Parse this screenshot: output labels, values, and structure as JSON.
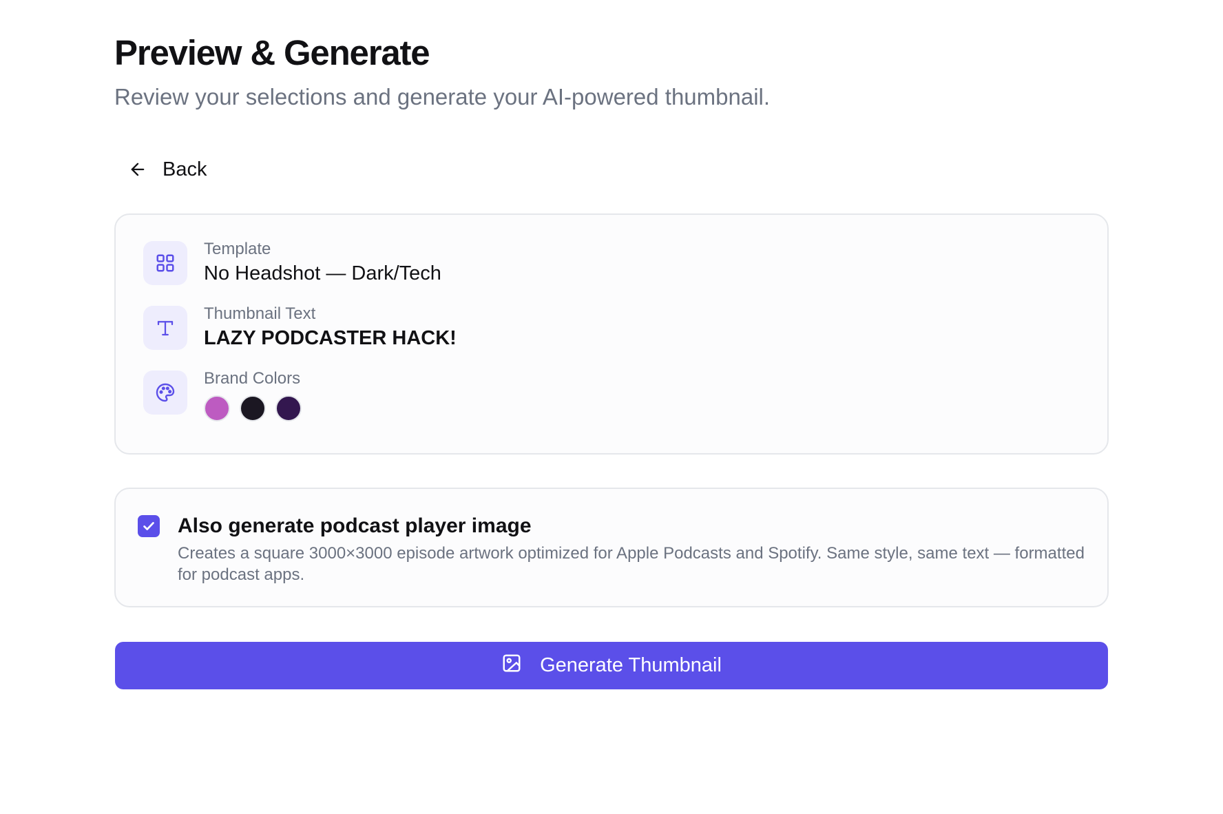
{
  "header": {
    "title": "Preview & Generate",
    "subtitle": "Review your selections and generate your AI-powered thumbnail."
  },
  "back_button": {
    "label": "Back",
    "icon": "arrow-left-icon"
  },
  "summary": {
    "template": {
      "label": "Template",
      "value": "No Headshot — Dark/Tech",
      "icon": "grid-icon"
    },
    "thumbnail_text": {
      "label": "Thumbnail Text",
      "value": "LAZY PODCASTER HACK!",
      "icon": "text-icon"
    },
    "brand_colors": {
      "label": "Brand Colors",
      "icon": "palette-icon",
      "colors": [
        "#bd5bc1",
        "#1b1722",
        "#33174f"
      ]
    }
  },
  "podcast_option": {
    "checked": true,
    "title": "Also generate podcast player image",
    "description": "Creates a square 3000×3000 episode artwork optimized for Apple Podcasts and Spotify. Same style, same text — formatted for podcast apps."
  },
  "generate_button": {
    "label": "Generate Thumbnail",
    "icon": "image-icon"
  },
  "theme": {
    "accent": "#5b4fe9",
    "icon_bg": "#eeedfd",
    "muted_text": "#6b7280",
    "border": "#e5e7eb"
  }
}
